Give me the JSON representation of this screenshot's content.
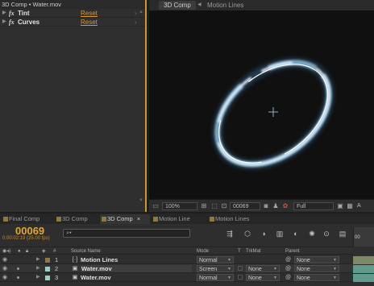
{
  "effect_controls": {
    "title": "3D Comp • Water.mov",
    "effects": [
      {
        "fx": "fx",
        "name": "Tint",
        "reset": "Reset"
      },
      {
        "fx": "fx",
        "name": "Curves",
        "reset": "Reset"
      }
    ]
  },
  "viewer": {
    "active_tab": "3D Comp",
    "next_tab": "Motion Lines",
    "zoom": "100%",
    "timecode": "00069",
    "resolution": "Full",
    "view_label": "A"
  },
  "timeline_tabs": [
    {
      "label": "Final Comp",
      "active": false
    },
    {
      "label": "3D Comp",
      "active": false
    },
    {
      "label": "3D Comp",
      "active": true,
      "close": "×"
    },
    {
      "label": "Motion Line",
      "active": false
    },
    {
      "label": "Motion Lines",
      "active": false
    }
  ],
  "timeline": {
    "frame": "00069",
    "subtime": "0:00:02:19 (25.00 fps)",
    "search_placeholder": "",
    "ruler_label": "00",
    "columns": {
      "source_name": "Source Name",
      "mode": "Mode",
      "t": "T",
      "trkmat": "TrkMat",
      "parent": "Parent"
    },
    "layers": [
      {
        "num": "1",
        "name": "Motion Lines",
        "mode": "Normal",
        "trkmat": "",
        "parent": "None",
        "label_color": "#8a7a44",
        "bar_color": "#7d8a6a",
        "is_comp": true
      },
      {
        "num": "2",
        "name": "Water.mov",
        "mode": "Screen",
        "trkmat": "None",
        "parent": "None",
        "label_color": "#9ad1c4",
        "bar_color": "#5f9c8e",
        "is_comp": false
      },
      {
        "num": "3",
        "name": "Water.mov",
        "mode": "Normal",
        "trkmat": "None",
        "parent": "None",
        "label_color": "#9ad1c4",
        "bar_color": "#5f9c8e",
        "is_comp": false
      }
    ]
  },
  "colors": {
    "accent_orange": "#e5a62c",
    "panel_border": "#c89a2a",
    "reset_link": "#d89a30"
  }
}
